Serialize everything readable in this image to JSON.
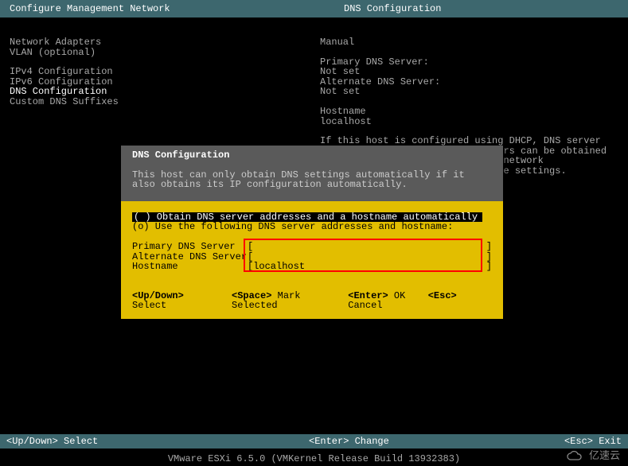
{
  "header": {
    "left": "Configure Management Network",
    "right": "DNS Configuration"
  },
  "left_menu": {
    "group1": [
      "Network Adapters",
      "VLAN (optional)"
    ],
    "group2": [
      "IPv4 Configuration",
      "IPv6 Configuration",
      "DNS Configuration",
      "Custom DNS Suffixes"
    ],
    "selected": "DNS Configuration"
  },
  "right_panel": {
    "heading": "Manual",
    "primary_label": "Primary DNS Server:",
    "primary_value": "Not set",
    "alternate_label": "Alternate DNS Server:",
    "alternate_value": "Not set",
    "hostname_label": "Hostname",
    "hostname_value": "localhost",
    "info": "If this host is configured using DHCP, DNS server addresses and other DNS parameters can be obtained automatically. If not, ask your network administrator for the appropriate settings."
  },
  "dialog": {
    "title": "DNS Configuration",
    "description": "This host can only obtain DNS settings automatically if it also obtains its IP configuration automatically.",
    "option_auto": "( ) Obtain DNS server addresses and a hostname automatically",
    "option_manual": "(o) Use the following DNS server addresses and hostname:",
    "primary_label": "Primary DNS Server",
    "primary_value": "",
    "alternate_label": "Alternate DNS Server",
    "alternate_value": "",
    "hostname_label": "Hostname",
    "hostname_value": "localhost",
    "hints": {
      "updown_key": "<Up/Down>",
      "updown_txt": "Select",
      "space_key": "<Space>",
      "space_txt": "Mark Selected",
      "enter_key": "<Enter>",
      "enter_txt": "OK",
      "esc_key": "<Esc>",
      "esc_txt": "Cancel"
    }
  },
  "footer": {
    "left": "<Up/Down> Select",
    "mid": "<Enter> Change",
    "right": "<Esc> Exit"
  },
  "version": "VMware ESXi 6.5.0 (VMKernel Release Build 13932383)",
  "watermark": "亿速云"
}
